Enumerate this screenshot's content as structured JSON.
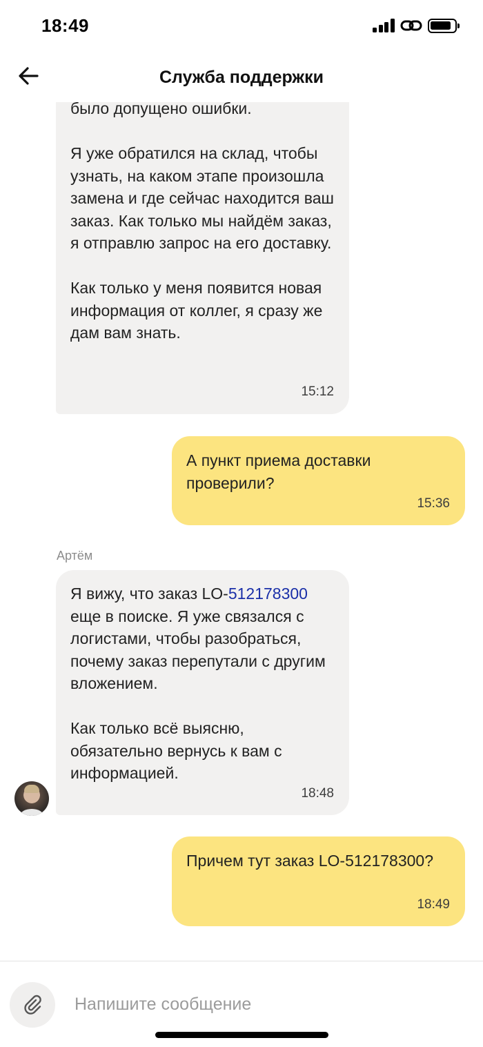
{
  "status_bar": {
    "time": "18:49",
    "icons": [
      "signal-icon",
      "link-icon",
      "battery-icon"
    ]
  },
  "header": {
    "title": "Служба поддержки",
    "back_icon": "arrow-left-icon"
  },
  "messages": [
    {
      "direction": "incoming",
      "text": "было допущено ошибки.\n\nЯ уже обратился на склад, чтобы узнать, на каком этапе произошла замена и где сейчас находится ваш заказ. Как только мы найдём заказ, я отправлю запрос на его доставку.\n\nКак только у меня появится новая информация от коллег, я сразу же дам вам знать.",
      "time": "15:12"
    },
    {
      "direction": "outgoing",
      "text": "А пункт приема доставки проверили?",
      "time": "15:36"
    },
    {
      "direction": "incoming",
      "sender": "Артём",
      "text_prefix": "Я вижу, что заказ LO-",
      "link": "512178300",
      "text_suffix": "\nеще в поиске. Я уже связался с логистами, чтобы разобраться, почему заказ перепутали с другим вложением.\n\nКак только всё выясню, обязательно вернусь к вам с информацией.",
      "time": "18:48"
    },
    {
      "direction": "outgoing",
      "text": "Причем тут заказ LO-512178300?",
      "time": "18:49"
    }
  ],
  "composer": {
    "placeholder": "Напишите сообщение",
    "value": "",
    "attach_icon": "paperclip-icon"
  },
  "colors": {
    "incoming_bubble": "#f2f1f0",
    "outgoing_bubble": "#fce480",
    "link": "#1a2fa8"
  }
}
